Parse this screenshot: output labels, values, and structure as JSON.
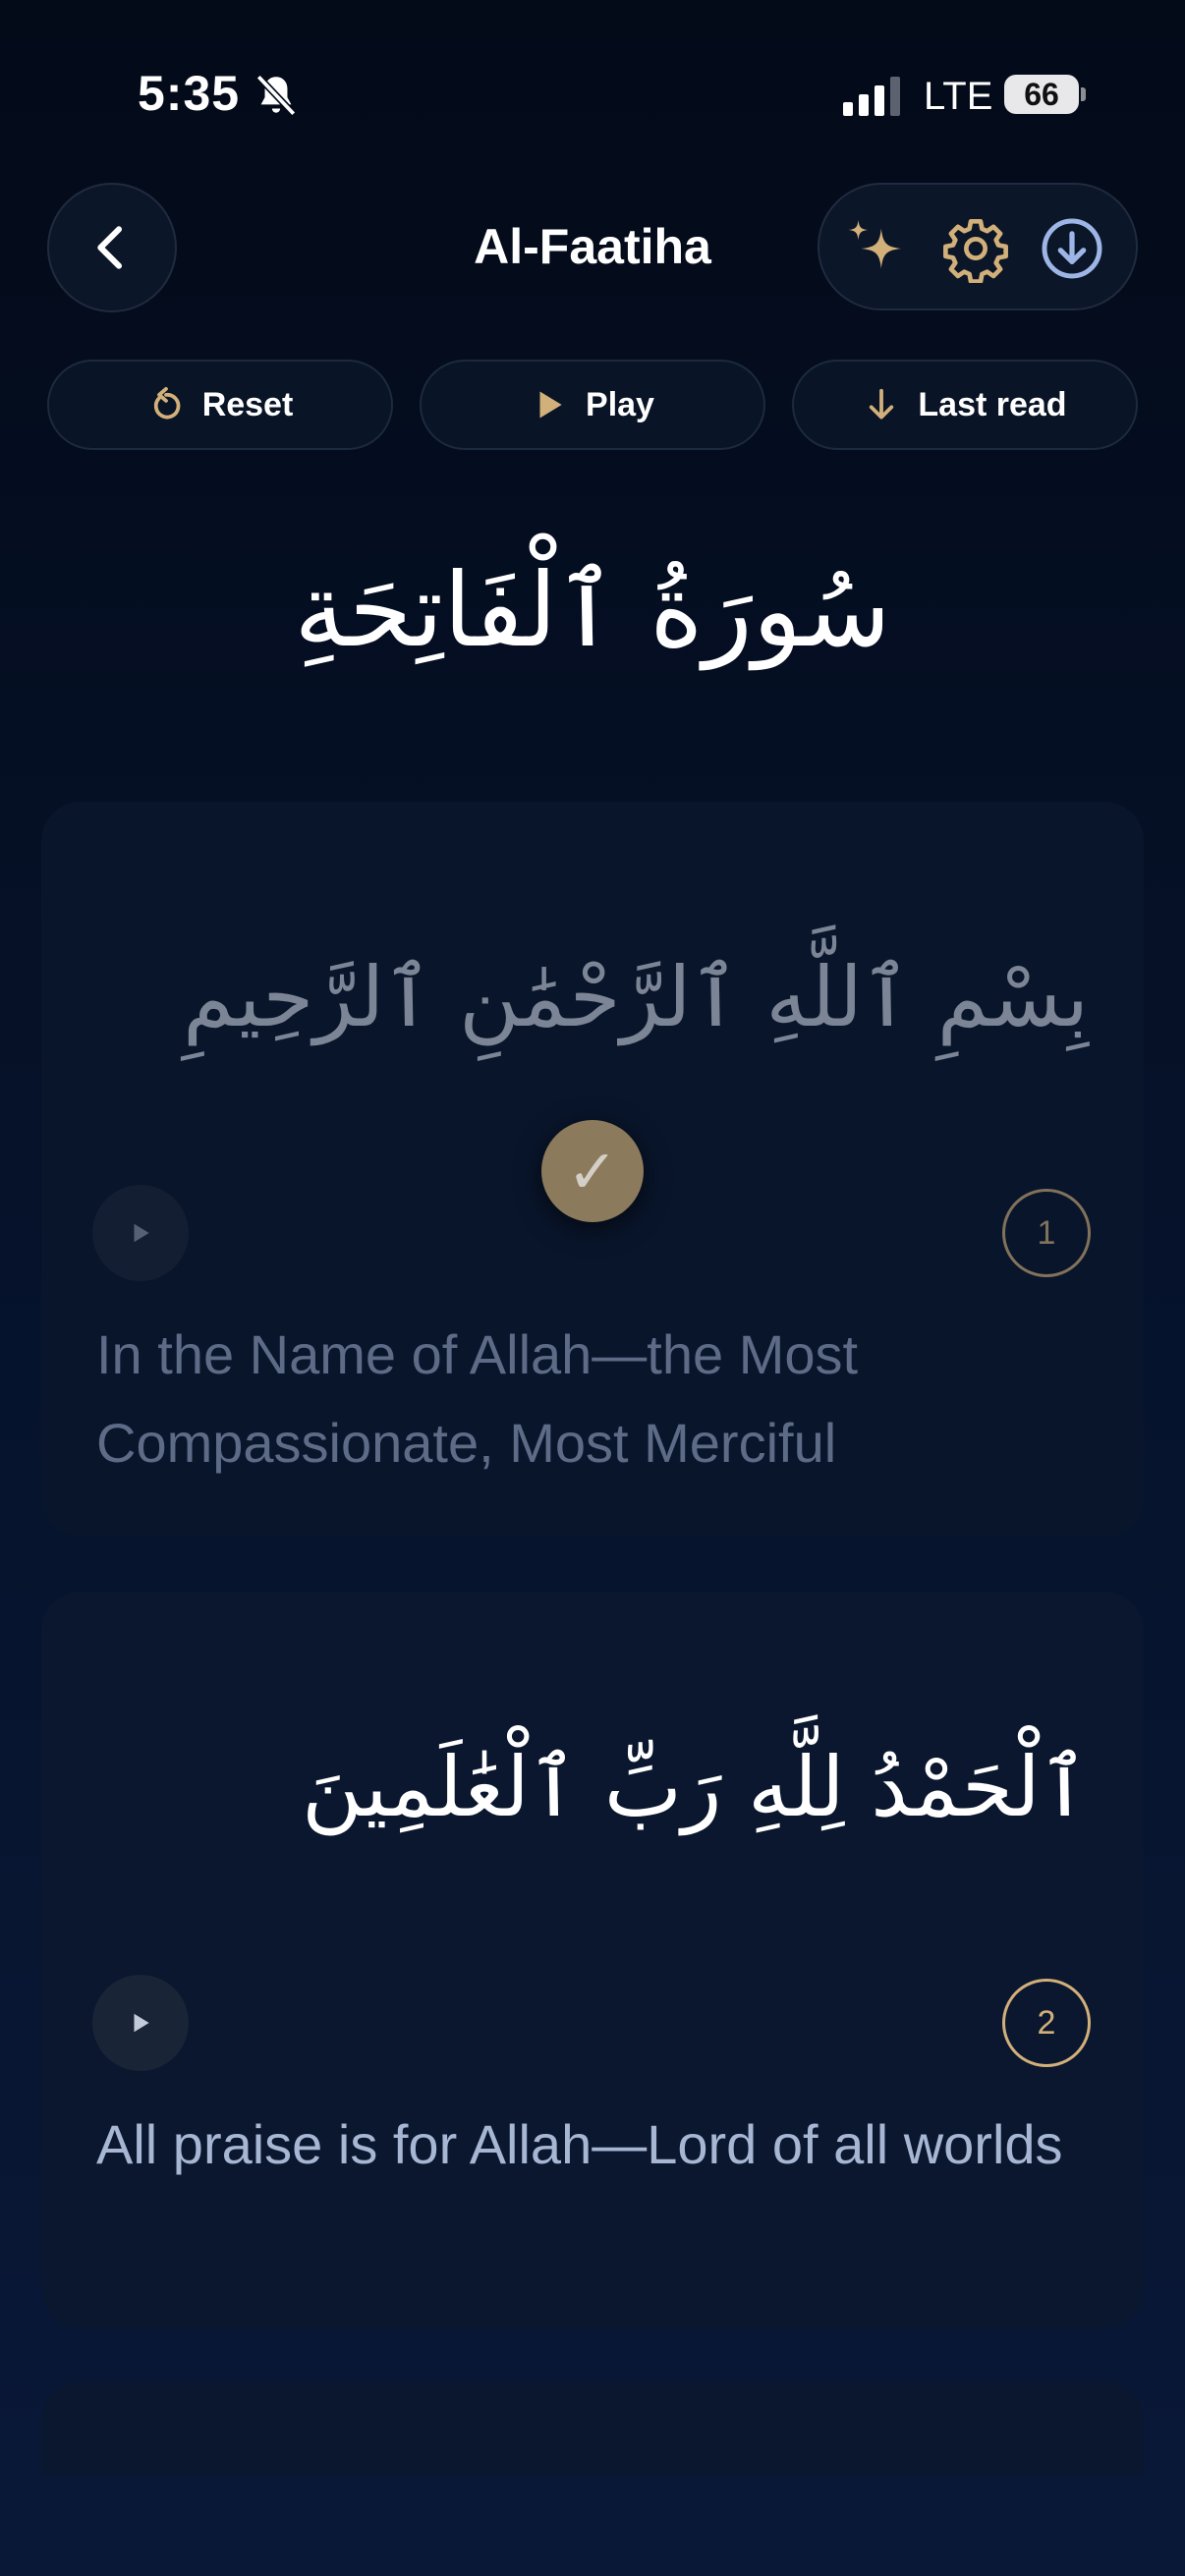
{
  "status_bar": {
    "time": "5:35",
    "network": "LTE",
    "battery": "66"
  },
  "header": {
    "title": "Al-Faatiha",
    "icons": [
      "back-chevron-icon",
      "sparkles-icon",
      "gear-icon",
      "download-icon"
    ]
  },
  "controls": {
    "reset": "Reset",
    "play": "Play",
    "last_read": "Last read"
  },
  "surah": {
    "arabic_name": "سُورَةُ ٱلْفَاتِحَةِ"
  },
  "verses": [
    {
      "number": "1",
      "arabic": "بِسْمِ ٱللَّهِ ٱلرَّحْمَٰنِ ٱلرَّحِيمِ",
      "translation": "In the Name of Allah—the Most Compassionate, Most Merciful",
      "read": true
    },
    {
      "number": "2",
      "arabic": "ٱلْحَمْدُ لِلَّهِ رَبِّ ٱلْعَٰلَمِينَ",
      "translation": "All praise is for Allah—Lord of all worlds",
      "read": false
    }
  ],
  "colors": {
    "background": "#050d1d",
    "accent_gold": "#d2b07a",
    "card": "#0a172f",
    "icon_blue": "#9db6e6"
  }
}
